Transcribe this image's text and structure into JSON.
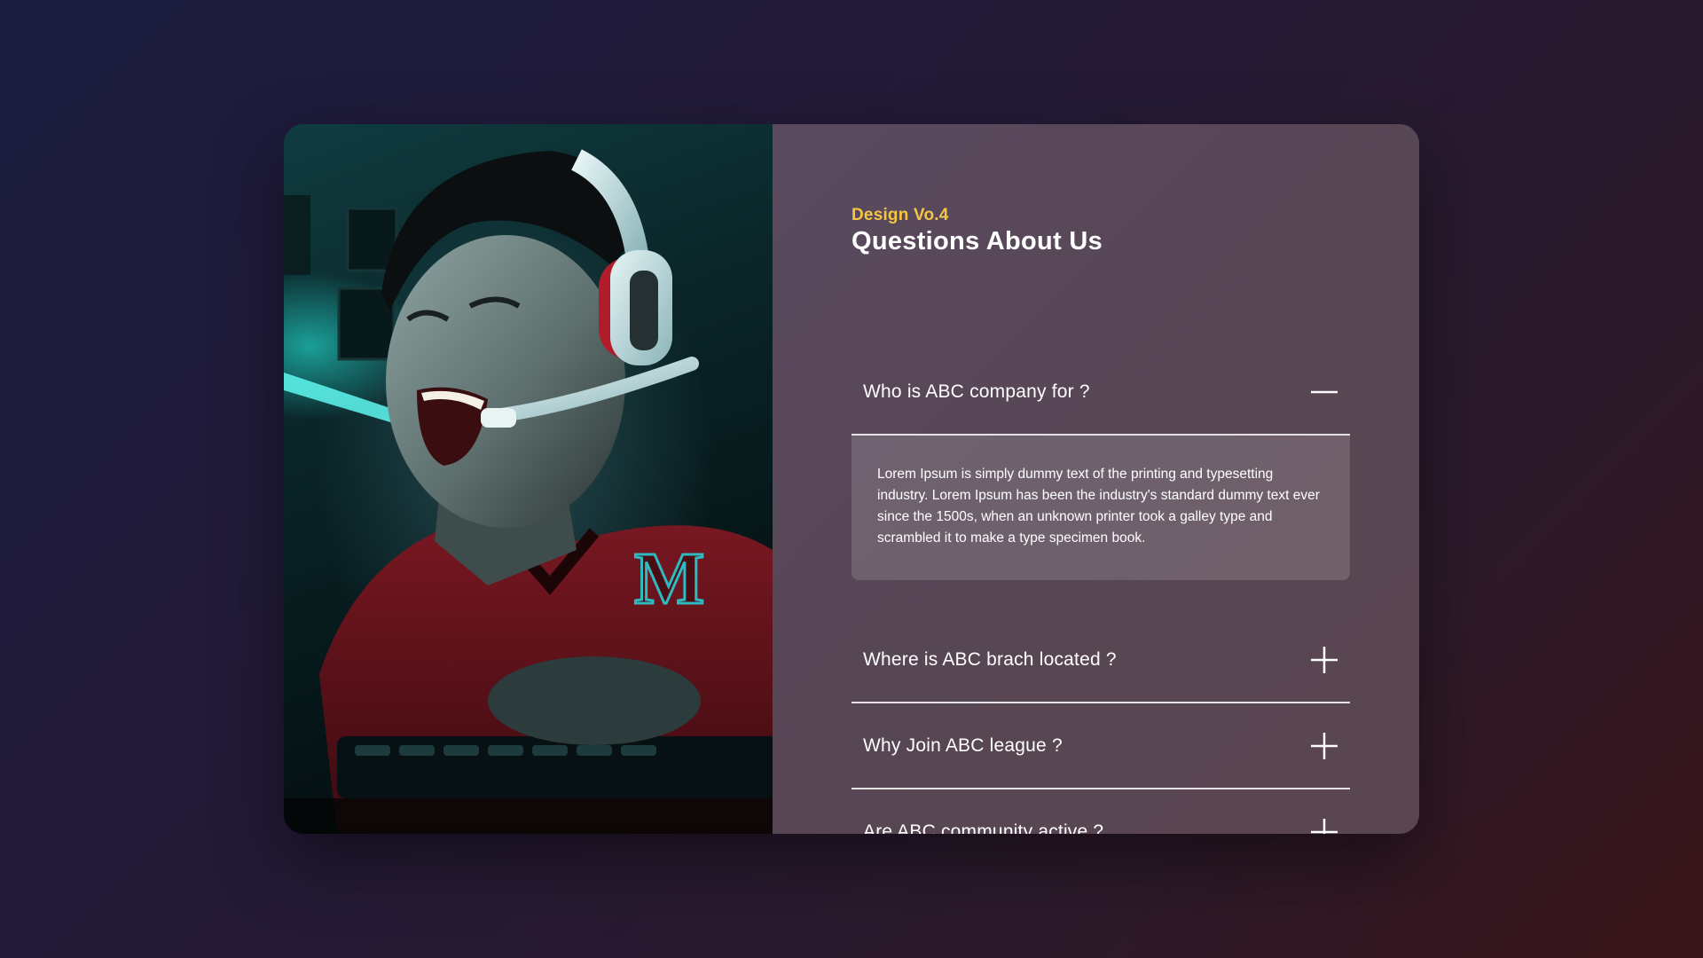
{
  "photo": {
    "alt_icon": "gamer-photo",
    "jersey_letter": "M"
  },
  "faq": {
    "eyebrow": "Design Vo.4",
    "title": "Questions About Us",
    "items": [
      {
        "question": "Who is ABC company for ?",
        "expanded": true,
        "icon": "minus-icon",
        "answer": "Lorem Ipsum is simply dummy text of the printing and typesetting industry. Lorem Ipsum has been the industry's standard dummy text ever since the 1500s, when an unknown printer took a galley type and scrambled it to make a type specimen book."
      },
      {
        "question": "Where is ABC brach located ?",
        "expanded": false,
        "icon": "plus-icon"
      },
      {
        "question": "Why Join ABC league ?",
        "expanded": false,
        "icon": "plus-icon"
      },
      {
        "question": "Are ABC community active ?",
        "expanded": false,
        "icon": "plus-icon"
      }
    ]
  },
  "colors": {
    "accent": "#f5c542",
    "panel": "#574654",
    "text": "#ffffff"
  }
}
